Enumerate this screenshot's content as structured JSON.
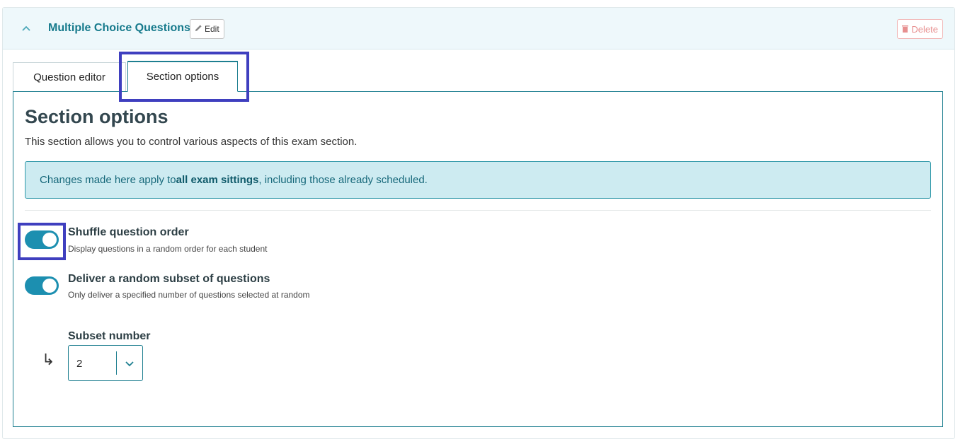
{
  "header": {
    "title": "Multiple Choice Questions",
    "edit_label": "Edit",
    "delete_label": "Delete"
  },
  "tabs": [
    {
      "label": "Question editor",
      "active": false
    },
    {
      "label": "Section options",
      "active": true
    }
  ],
  "main": {
    "title": "Section options",
    "description": "This section allows you to control various aspects of this exam section.",
    "alert": {
      "prefix": "Changes made here apply to ",
      "bold": "all exam sittings",
      "suffix": ", including those already scheduled."
    },
    "options": [
      {
        "title": "Shuffle question order",
        "description": "Display questions in a random order for each student",
        "enabled": true
      },
      {
        "title": "Deliver a random subset of questions",
        "description": "Only deliver a specified number of questions selected at random",
        "enabled": true
      }
    ],
    "subset": {
      "label": "Subset number",
      "value": "2",
      "arrow_glyph": "↳"
    }
  },
  "colors": {
    "accent": "#1e7f90",
    "toggle_on": "#1c8fb0",
    "highlight": "#3f3fbf",
    "alert_bg": "#cdebf1",
    "danger": "#e79090"
  },
  "icons": {
    "collapse": "chevron-up-icon",
    "edit": "pencil-icon",
    "delete": "trash-icon",
    "subset_arrow": "subdirectory-arrow-icon",
    "select": "chevron-down-icon"
  }
}
